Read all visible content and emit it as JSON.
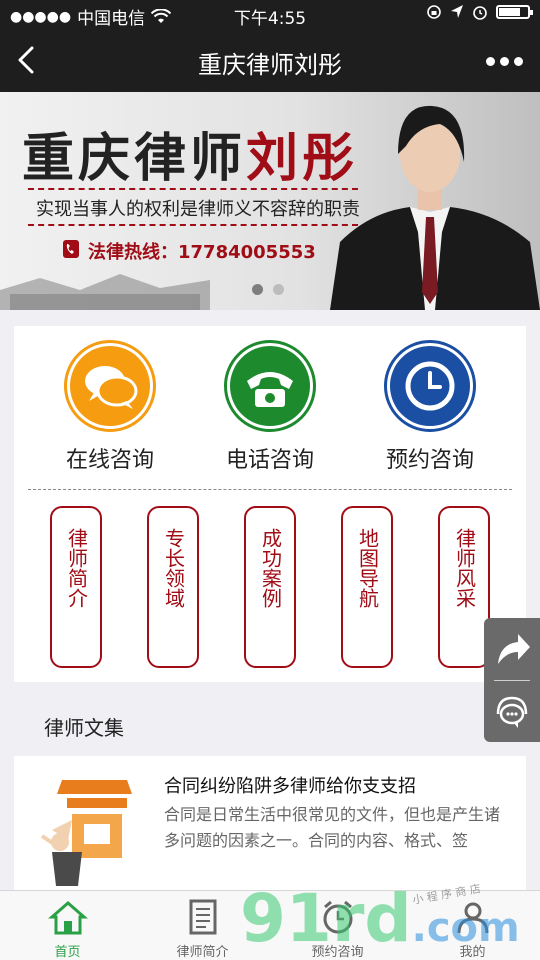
{
  "status_bar": {
    "signal": "●●●●●",
    "carrier": "中国电信",
    "time": "下午4:55"
  },
  "nav": {
    "title": "重庆律师刘彤",
    "back_icon": "chevron-left-icon",
    "more_icon": "more-dots-icon"
  },
  "banner": {
    "headline_prefix": "重庆律师",
    "headline_name": "刘彤",
    "slogan": "实现当事人的权利是律师义不容辞的职责",
    "hotline": "法律热线：17784005553",
    "pager_total": 2,
    "pager_active": 1
  },
  "services": {
    "items": [
      {
        "label": "在线咨询",
        "icon": "chat-bubbles-icon",
        "color": "#f59c11"
      },
      {
        "label": "电话咨询",
        "icon": "telephone-icon",
        "color": "#1d8a2e"
      },
      {
        "label": "预约咨询",
        "icon": "clock-icon",
        "color": "#1a4fa3"
      }
    ],
    "sub_items": [
      {
        "label": "律师简介"
      },
      {
        "label": "专长领域"
      },
      {
        "label": "成功案例"
      },
      {
        "label": "地图导航"
      },
      {
        "label": "律师风采"
      }
    ]
  },
  "float_tools": {
    "share_icon": "share-icon",
    "service_icon": "customer-service-icon"
  },
  "articles": {
    "section_title": "律师文集",
    "items": [
      {
        "title": "合同纠纷陷阱多律师给你支支招",
        "desc": "合同是日常生活中很常见的文件，但也是产生诸多问题的因素之一。合同的内容、格式、签"
      }
    ]
  },
  "tabbar": {
    "items": [
      {
        "label": "首页",
        "icon": "home-icon",
        "active": true
      },
      {
        "label": "律师简介",
        "icon": "document-icon",
        "active": false
      },
      {
        "label": "预约咨询",
        "icon": "alarm-clock-icon",
        "active": false
      },
      {
        "label": "我的",
        "icon": "user-icon",
        "active": false
      }
    ]
  },
  "watermark": {
    "text": "91rd",
    "suffix": ".com",
    "small": "小 程 序 商 店"
  },
  "colors": {
    "accent_red": "#a00d16",
    "tab_active": "#2aa047",
    "dark_bar": "#1e1e1e"
  }
}
